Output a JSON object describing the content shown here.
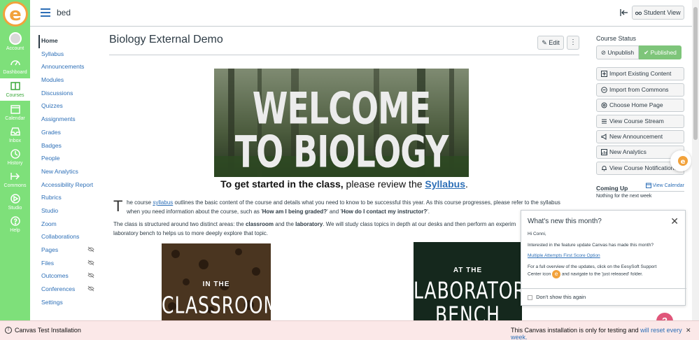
{
  "colors": {
    "nav_green": "#7ee07a",
    "link_blue": "#2d6fb7",
    "published_green": "#7ec57a",
    "banner_pink": "#fbe8e8",
    "eesy_orange": "#f2a23b"
  },
  "global_nav": [
    {
      "label": "Account",
      "icon": "account-avatar"
    },
    {
      "label": "Dashboard",
      "icon": "dashboard-icon"
    },
    {
      "label": "Courses",
      "icon": "courses-icon"
    },
    {
      "label": "Calendar",
      "icon": "calendar-icon"
    },
    {
      "label": "Inbox",
      "icon": "inbox-icon"
    },
    {
      "label": "History",
      "icon": "history-icon"
    },
    {
      "label": "Commons",
      "icon": "commons-icon"
    },
    {
      "label": "Studio",
      "icon": "studio-icon"
    },
    {
      "label": "Help",
      "icon": "help-icon"
    }
  ],
  "header": {
    "breadcrumb": "bed",
    "student_view": "Student View"
  },
  "course_nav": {
    "items": [
      "Home",
      "Syllabus",
      "Announcements",
      "Modules",
      "Discussions",
      "Quizzes",
      "Assignments",
      "Grades",
      "Badges",
      "People",
      "New Analytics",
      "Accessibility Report",
      "Rubrics",
      "Studio",
      "Zoom",
      "Collaborations",
      "Pages",
      "Files",
      "Outcomes",
      "Conferences",
      "Settings"
    ]
  },
  "main": {
    "title": "Biology External Demo",
    "edit_label": "Edit",
    "more_label": "⋮",
    "hero_line1": "WELCOME",
    "hero_line2": "TO BIOLOGY",
    "start_bold": "To get started in the class,",
    "start_rest": " please review the ",
    "start_link": "Syllabus",
    "start_end": ".",
    "dropcap": "T",
    "p1_a": "he course ",
    "p1_link": "syllabus",
    "p1_b": " outlines the basic content of the course and details what you need to know to be successful this year. As this course progresses, please refer to the syllabus",
    "p1_c": "when you need information about the course, such as '",
    "p1_q1": "How am I being graded?",
    "p1_d": "' and '",
    "p1_q2": "How do I contact my instructor?",
    "p1_e": "'.",
    "p2_a": "The class is structured around two distinct areas: the ",
    "p2_b1": "classroom",
    "p2_c": " and the ",
    "p2_b2": "laboratory",
    "p2_d": ". We will study class topics in depth at our desks and then perform an experim",
    "p2_line2": "laboratory bench to helps us to more deeply explore that topic.",
    "img1_small": "IN THE",
    "img1_big": "CLASSROOM",
    "img2_small": "AT THE",
    "img2_big1": "LABORATORY",
    "img2_big2": "BENCH"
  },
  "sidebar": {
    "status_heading": "Course Status",
    "unpublish": "Unpublish",
    "published": "Published",
    "buttons": [
      "Import Existing Content",
      "Import from Commons",
      "Choose Home Page",
      "View Course Stream",
      "New Announcement",
      "New Analytics",
      "View Course Notifications"
    ],
    "coming_up": "Coming Up",
    "view_calendar": "View Calendar",
    "nothing": "Nothing for the next week"
  },
  "popup": {
    "title": "What's new this month?",
    "close": "✕",
    "greeting": "Hi Conni,",
    "line1": "Interested in the feature update Canvas has made this month?",
    "link": "Multiple Attempts First Score Option",
    "line2a": "For a full overview of the updates, click on the EesySoft Support",
    "line2b": "Center icon",
    "line2c": "and navigate to the 'just released' folder.",
    "dont_show": "Don't show this again"
  },
  "banner": {
    "title": "Canvas Test Installation",
    "msg": "This Canvas installation is only for testing and ",
    "msg_link": "will reset every week.",
    "close": "✕"
  },
  "help_bubble": "?"
}
